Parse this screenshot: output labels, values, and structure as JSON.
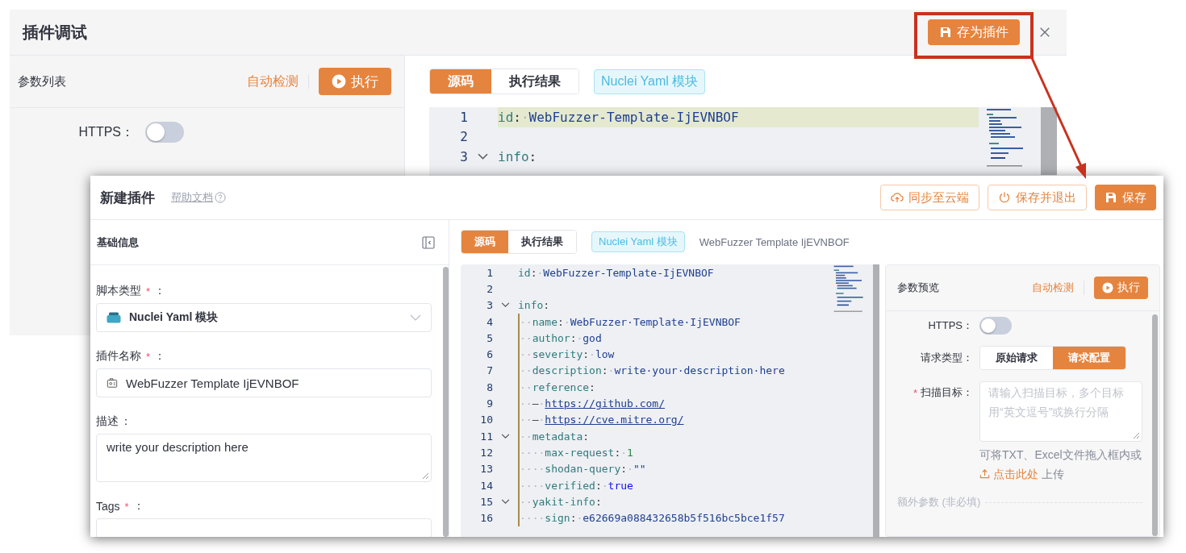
{
  "back_window": {
    "title": "插件调试",
    "save_as_plugin_button": "存为插件",
    "params_panel": {
      "title": "参数列表",
      "auto_detect": "自动检测",
      "run_button": "执行",
      "https": {
        "label": "HTTPS：",
        "on": false
      }
    },
    "tabs": [
      {
        "label": "源码",
        "selected": true
      },
      {
        "label": "执行结果",
        "selected": false
      }
    ],
    "type_tag": "Nuclei Yaml 模块",
    "code_lines": [
      {
        "num": "1",
        "highlighted": true,
        "fold": false,
        "tokens": [
          {
            "kind": "key",
            "text": "id"
          },
          {
            "kind": "punct",
            "text": ":"
          },
          {
            "kind": "ws",
            "text": "·"
          },
          {
            "kind": "value",
            "text": "WebFuzzer-Template-IjEVNBOF"
          }
        ]
      },
      {
        "num": "2",
        "highlighted": false,
        "fold": false
      },
      {
        "num": "3",
        "highlighted": false,
        "fold": true,
        "tokens": [
          {
            "kind": "key",
            "text": "info"
          },
          {
            "kind": "punct",
            "text": ":"
          }
        ]
      }
    ]
  },
  "front_window": {
    "title": "新建插件",
    "help_link": "帮助文档",
    "buttons": [
      {
        "label": "同步至云端",
        "kind": "sync"
      },
      {
        "label": "保存并退出",
        "kind": "exit"
      },
      {
        "label": "保存",
        "kind": "save"
      }
    ],
    "basic_info": {
      "title": "基础信息",
      "fields": [
        {
          "kind": "select",
          "label": "脚本类型",
          "mark": "*",
          "colon": "：",
          "value": "Nuclei Yaml 模块"
        },
        {
          "kind": "input",
          "label": "插件名称",
          "mark": "*",
          "colon": "：",
          "value": "WebFuzzer Template IjEVNBOF"
        },
        {
          "kind": "textarea",
          "label": "描述",
          "colon": "：",
          "value": "write your description here"
        },
        {
          "kind": "tags",
          "label": "Tags",
          "mark": "*",
          "colon": "："
        }
      ]
    },
    "tabs": [
      {
        "label": "源码",
        "selected": true
      },
      {
        "label": "执行结果",
        "selected": false
      }
    ],
    "type_tag": "Nuclei Yaml 模块",
    "plugin_name": "WebFuzzer Template IjEVNBOF",
    "code_lines": [
      {
        "num": "1",
        "fold": false,
        "tokens": [
          {
            "kind": "key",
            "text": "id"
          },
          {
            "kind": "punct",
            "text": ":"
          },
          {
            "kind": "ws",
            "text": "·"
          },
          {
            "kind": "value",
            "text": "WebFuzzer-Template-IjEVNBOF"
          }
        ]
      },
      {
        "num": "2",
        "fold": false
      },
      {
        "num": "3",
        "fold": true,
        "tokens": [
          {
            "kind": "key",
            "text": "info"
          },
          {
            "kind": "punct",
            "text": ":"
          }
        ]
      },
      {
        "num": "4",
        "fold": false,
        "tokens": [
          {
            "kind": "ws",
            "text": "··"
          },
          {
            "kind": "key",
            "text": "name"
          },
          {
            "kind": "punct",
            "text": ":"
          },
          {
            "kind": "ws",
            "text": "·"
          },
          {
            "kind": "value",
            "text": "WebFuzzer·Template·IjEVNBOF"
          }
        ]
      },
      {
        "num": "5",
        "fold": false,
        "tokens": [
          {
            "kind": "ws",
            "text": "··"
          },
          {
            "kind": "key",
            "text": "author"
          },
          {
            "kind": "punct",
            "text": ":"
          },
          {
            "kind": "ws",
            "text": "·"
          },
          {
            "kind": "value",
            "text": "god"
          }
        ]
      },
      {
        "num": "6",
        "fold": false,
        "tokens": [
          {
            "kind": "ws",
            "text": "··"
          },
          {
            "kind": "key",
            "text": "severity"
          },
          {
            "kind": "punct",
            "text": ":"
          },
          {
            "kind": "ws",
            "text": "·"
          },
          {
            "kind": "value",
            "text": "low"
          }
        ]
      },
      {
        "num": "7",
        "fold": false,
        "tokens": [
          {
            "kind": "ws",
            "text": "··"
          },
          {
            "kind": "key",
            "text": "description"
          },
          {
            "kind": "punct",
            "text": ":"
          },
          {
            "kind": "ws",
            "text": "·"
          },
          {
            "kind": "value",
            "text": "write·your·description·here"
          }
        ]
      },
      {
        "num": "8",
        "fold": false,
        "tokens": [
          {
            "kind": "ws",
            "text": "··"
          },
          {
            "kind": "key",
            "text": "reference"
          },
          {
            "kind": "punct",
            "text": ":"
          }
        ]
      },
      {
        "num": "9",
        "fold": false,
        "tokens": [
          {
            "kind": "ws",
            "text": "··"
          },
          {
            "kind": "punct",
            "text": "–"
          },
          {
            "kind": "ws",
            "text": "·"
          },
          {
            "kind": "link",
            "text": "https://github.com/"
          }
        ]
      },
      {
        "num": "10",
        "fold": false,
        "tokens": [
          {
            "kind": "ws",
            "text": "··"
          },
          {
            "kind": "punct",
            "text": "–"
          },
          {
            "kind": "ws",
            "text": "·"
          },
          {
            "kind": "link",
            "text": "https://cve.mitre.org/"
          }
        ]
      },
      {
        "num": "11",
        "fold": true,
        "tokens": [
          {
            "kind": "ws",
            "text": "··"
          },
          {
            "kind": "key",
            "text": "metadata"
          },
          {
            "kind": "punct",
            "text": ":"
          }
        ]
      },
      {
        "num": "12",
        "fold": false,
        "tokens": [
          {
            "kind": "ws",
            "text": "····"
          },
          {
            "kind": "key",
            "text": "max-request"
          },
          {
            "kind": "punct",
            "text": ":"
          },
          {
            "kind": "ws",
            "text": "·"
          },
          {
            "kind": "number",
            "text": "1"
          }
        ]
      },
      {
        "num": "13",
        "fold": false,
        "tokens": [
          {
            "kind": "ws",
            "text": "····"
          },
          {
            "kind": "key",
            "text": "shodan-query"
          },
          {
            "kind": "punct",
            "text": ":"
          },
          {
            "kind": "ws",
            "text": "·"
          },
          {
            "kind": "value",
            "text": "\"\""
          }
        ]
      },
      {
        "num": "14",
        "fold": false,
        "tokens": [
          {
            "kind": "ws",
            "text": "····"
          },
          {
            "kind": "key",
            "text": "verified"
          },
          {
            "kind": "punct",
            "text": ":"
          },
          {
            "kind": "ws",
            "text": "·"
          },
          {
            "kind": "bool",
            "text": "true"
          }
        ]
      },
      {
        "num": "15",
        "fold": true,
        "tokens": [
          {
            "kind": "ws",
            "text": "··"
          },
          {
            "kind": "key",
            "text": "yakit-info"
          },
          {
            "kind": "punct",
            "text": ":"
          }
        ]
      },
      {
        "num": "16",
        "fold": false,
        "tokens": [
          {
            "kind": "ws",
            "text": "····"
          },
          {
            "kind": "key",
            "text": "sign"
          },
          {
            "kind": "punct",
            "text": ":"
          },
          {
            "kind": "ws",
            "text": "·"
          },
          {
            "kind": "value",
            "text": "e62669a088432658b5f516bc5bce1f57"
          }
        ]
      }
    ],
    "params_preview": {
      "title": "参数预览",
      "auto_detect": "自动检测",
      "run_button": "执行",
      "https": {
        "label": "HTTPS：",
        "on": false
      },
      "request_type": {
        "label": "请求类型：",
        "options": [
          {
            "label": "原始请求",
            "selected": false
          },
          {
            "label": "请求配置",
            "selected": true
          }
        ]
      },
      "scan_target": {
        "mark": "*",
        "label": "扫描目标：",
        "placeholder": "请输入扫描目标，多个目标用“英文逗号”或换行分隔"
      },
      "upload_hint": {
        "before": "可将TXT、Excel文件拖入框内或",
        "link": "点击此处",
        "after": "上传"
      },
      "extra_params": "额外参数 (非必填)"
    }
  }
}
